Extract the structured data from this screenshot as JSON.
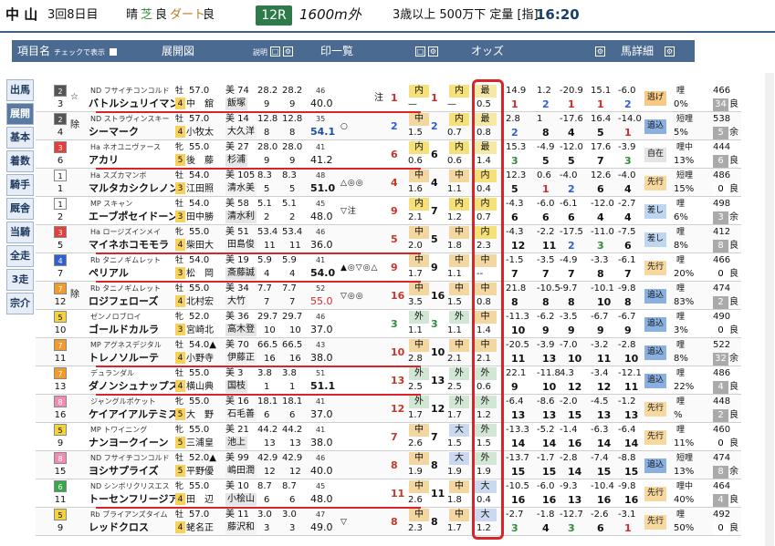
{
  "header": {
    "place": "中 山",
    "meeting": "3回8日目",
    "weather": "晴",
    "turf_label": "芝",
    "turf": "良",
    "dirt_label": "ダート",
    "dirt": "良",
    "race_num": "12R",
    "distance": "1600m外",
    "conditions": "3歳以上 500万下 定量 [指]",
    "post_time": "16:20"
  },
  "columns": {
    "name": "項目名",
    "check": "チェックで表示",
    "chart": "展開図",
    "chart_sub": "説明",
    "marks": "印一覧",
    "odds": "オッズ",
    "detail": "馬詳細"
  },
  "side": [
    "出馬",
    "展開",
    "基本",
    "着数",
    "騎手",
    "厩舎",
    "当騎",
    "全走",
    "3走",
    "宗介"
  ],
  "rows": [
    {
      "wk": "2",
      "n": "3",
      "mk": "☆",
      "ic": "ND",
      "sire": "フサイチコンコルド",
      "name": "バトルシュリイマン",
      "sex": "牡",
      "age": "4",
      "kg": "57.0",
      "jk": "中　舘",
      "tr": "美 74",
      "trn": "飯塚",
      "t1": "28.2",
      "t2": "28.2",
      "p1": "9",
      "p2": "9",
      "od1": "46",
      "od2": "40.0",
      "sy": "",
      "ta": "注",
      "nb": "1",
      "b1": "内",
      "v1": "—",
      "n1": "1",
      "b2": "内",
      "v2": "—",
      "ob": "最",
      "ov": "0.5",
      "c1": "14.9",
      "d1": "1",
      "c2": "1.2",
      "d2": "2",
      "c3": "-20.9",
      "d3": "1",
      "c4": "15.1",
      "d4": "1",
      "c5": "-6.0",
      "d5": "2",
      "sty": "逃げ",
      "ln": "哩",
      "pc": "0%",
      "wt": "466",
      "gd": "34",
      "cnd": "良"
    },
    {
      "wk": "2",
      "n": "4",
      "mk": "除",
      "ic": "ND",
      "sire": "ストラヴィンスキー",
      "name": "シーマーク",
      "sex": "牡",
      "age": "4",
      "kg": "57.0",
      "jk": "小牧太",
      "tr": "美 14",
      "trn": "大久洋",
      "t1": "12.8",
      "t2": "12.8",
      "p1": "8",
      "p2": "8",
      "od1": "35",
      "od2": "54.1",
      "sy": "○",
      "ta": "",
      "nb": "2",
      "b1": "中",
      "v1": "1.5",
      "n1": "2",
      "b2": "内",
      "v2": "0.7",
      "ob": "最",
      "ov": "0.8",
      "c1": "2.8",
      "d1": "2",
      "c2": "1",
      "d2": "8",
      "c3": "-17.6",
      "d3": "4",
      "c4": "16.4",
      "d4": "5",
      "c5": "-14.0",
      "d5": "1",
      "sty": "追込",
      "ln": "短哩",
      "pc": "5%",
      "wt": "538",
      "gd": "5",
      "cnd": "余"
    },
    {
      "wk": "3",
      "n": "6",
      "mk": "",
      "ic": "Ha",
      "sire": "ネオユニヴァース",
      "name": "アカリ",
      "sex": "牝",
      "age": "5",
      "kg": "55.0",
      "jk": "後　藤",
      "tr": "美 27",
      "trn": "杉浦",
      "t1": "28.0",
      "t2": "28.0",
      "p1": "9",
      "p2": "9",
      "od1": "41",
      "od2": "41.2",
      "sy": "",
      "ta": "",
      "nb": "6",
      "b1": "内",
      "v1": "0.6",
      "n1": "6",
      "b2": "内",
      "v2": "0.6",
      "ob": "最",
      "ov": "1.4",
      "c1": "15.3",
      "d1": "3",
      "c2": "-4.9",
      "d2": "5",
      "c3": "-12.0",
      "d3": "5",
      "c4": "17.6",
      "d4": "7",
      "c5": "-3.9",
      "d5": "3",
      "sty": "自在",
      "ln": "哩中",
      "pc": "13%",
      "wt": "444",
      "gd": "6",
      "cnd": "良"
    },
    {
      "wk": "1",
      "n": "1",
      "mk": "",
      "ic": "Ha",
      "sire": "スズカマンボ",
      "name": "マルタカシクレノン",
      "sex": "牡",
      "age": "3",
      "kg": "54.0",
      "jk": "江田照",
      "tr": "美 105",
      "trn": "清水美",
      "t1": "8.3",
      "t2": "8.3",
      "p1": "5",
      "p2": "5",
      "od1": "48",
      "od2": "51.0",
      "sy": "△◎◎",
      "ta": "",
      "nb": "4",
      "b1": "中",
      "v1": "1.6",
      "n1": "4",
      "b2": "中",
      "v2": "1.1",
      "ob": "内",
      "ov": "0.4",
      "c1": "12.3",
      "d1": "5",
      "c2": "0.6",
      "d2": "1",
      "c3": "-4.0",
      "d3": "2",
      "c4": "12.6",
      "d4": "6",
      "c5": "-4.0",
      "d5": "4",
      "sty": "先行",
      "ln": "短哩",
      "pc": "15%",
      "wt": "486",
      "gd": "0",
      "cnd": "良"
    },
    {
      "wk": "1",
      "n": "2",
      "mk": "",
      "ic": "MP",
      "sire": "スキャン",
      "name": "エーブポセイドーン",
      "sex": "牡",
      "age": "3",
      "kg": "54.0",
      "jk": "田中勝",
      "tr": "美 58",
      "trn": "清水利",
      "t1": "5.1",
      "t2": "5.1",
      "p1": "2",
      "p2": "2",
      "od1": "45",
      "od2": "48.0",
      "sy": "▽注",
      "ta": "",
      "nb": "9",
      "b1": "内",
      "v1": "2.1",
      "n1": "7",
      "b2": "内",
      "v2": "1.2",
      "ob": "内",
      "ov": "0.7",
      "c1": "-4.3",
      "d1": "6",
      "c2": "-6.0",
      "d2": "6",
      "c3": "-6.1",
      "d3": "6",
      "c4": "-12.0",
      "d4": "4",
      "c5": "-2.7",
      "d5": "4",
      "sty": "差し",
      "ln": "哩",
      "pc": "6%",
      "wt": "498",
      "gd": "3",
      "cnd": "余"
    },
    {
      "wk": "3",
      "n": "5",
      "mk": "",
      "ic": "Ha",
      "sire": "ロージズインメイ",
      "name": "マイネホコモモラ",
      "sex": "牝",
      "age": "4",
      "kg": "55.0",
      "jk": "柴田大",
      "tr": "美 51",
      "trn": "田島俊",
      "t1": "53.4",
      "t2": "53.4",
      "p1": "11",
      "p2": "11",
      "od1": "46",
      "od2": "36.0",
      "sy": "",
      "ta": "",
      "nb": "5",
      "b1": "中",
      "v1": "2.0",
      "n1": "5",
      "b2": "中",
      "v2": "1.8",
      "ob": "内",
      "ov": "2.3",
      "c1": "-4.3",
      "d1": "12",
      "c2": "-2.2",
      "d2": "11",
      "c3": "-17.5",
      "d3": "2",
      "c4": "-11.0",
      "d4": "3",
      "c5": "-7.5",
      "d5": "6",
      "sty": "差し",
      "ln": "哩",
      "pc": "8%",
      "wt": "412",
      "gd": "8",
      "cnd": "良"
    },
    {
      "wk": "4",
      "n": "7",
      "mk": "",
      "ic": "Rb",
      "sire": "タニノギムレット",
      "name": "ペリアル",
      "sex": "牡",
      "age": "3",
      "kg": "54.0",
      "jk": "松　岡",
      "tr": "美 19",
      "trn": "斎藤誠",
      "t1": "5.9",
      "t2": "5.9",
      "p1": "4",
      "p2": "4",
      "od1": "41",
      "od2": "54.0",
      "sy": "▲◎▽◎△",
      "ta": "",
      "nb": "9",
      "b1": "中",
      "v1": "1.7",
      "n1": "9",
      "b2": "中",
      "v2": "1.1",
      "ob": "中",
      "ov": "--",
      "c1": "-1.5",
      "d1": "7",
      "c2": "-3.5",
      "d2": "7",
      "c3": "-4.9",
      "d3": "7",
      "c4": "-3.3",
      "d4": "8",
      "c5": "-6.1",
      "d5": "7",
      "sty": "先行",
      "ln": "哩",
      "pc": "20%",
      "wt": "466",
      "gd": "0",
      "cnd": "良"
    },
    {
      "wk": "7",
      "n": "12",
      "mk": "除",
      "ic": "Rb",
      "sire": "タニノギムレット",
      "name": "ロジフェローズ",
      "sex": "牡",
      "age": "4",
      "kg": "55.0",
      "jk": "北村宏",
      "tr": "美 34",
      "trn": "大竹",
      "t1": "7.7",
      "t2": "7.7",
      "p1": "7",
      "p2": "7",
      "od1": "52",
      "od2": "55.0",
      "sy": "▽◎◎",
      "ta": "",
      "nb": "16",
      "b1": "中",
      "v1": "3.5",
      "n1": "16",
      "b2": "中",
      "v2": "1.5",
      "ob": "中",
      "ov": "0.8",
      "c1": "21.8",
      "d1": "8",
      "c2": "-10.5",
      "d2": "8",
      "c3": "-9.7",
      "d3": "8",
      "c4": "-10.1",
      "d4": "10",
      "c5": "-9.8",
      "d5": "8",
      "sty": "追込",
      "ln": "哩",
      "pc": "83%",
      "wt": "474",
      "gd": "2",
      "cnd": "良"
    },
    {
      "wk": "5",
      "n": "10",
      "mk": "",
      "ic": "",
      "sire": "ゼンノロブロイ",
      "name": "ゴールドカルラ",
      "sex": "牝",
      "age": "3",
      "kg": "52.0",
      "jk": "宮崎北",
      "tr": "美 36",
      "trn": "高木登",
      "t1": "29.7",
      "t2": "29.7",
      "p1": "10",
      "p2": "10",
      "od1": "46",
      "od2": "37.0",
      "sy": "",
      "ta": "",
      "nb": "3",
      "b1": "外",
      "v1": "1.1",
      "n1": "3",
      "b2": "外",
      "v2": "1.1",
      "ob": "中",
      "ov": "1.4",
      "c1": "-11.3",
      "d1": "10",
      "c2": "-6.2",
      "d2": "9",
      "c3": "-3.5",
      "d3": "9",
      "c4": "-6.7",
      "d4": "9",
      "c5": "-6.7",
      "d5": "9",
      "sty": "追込",
      "ln": "哩",
      "pc": "3%",
      "wt": "490",
      "gd": "0",
      "cnd": "良"
    },
    {
      "wk": "7",
      "n": "11",
      "mk": "",
      "ic": "MP",
      "sire": "アグネスデジタル",
      "name": "トレノソルーテ",
      "sex": "牡",
      "age": "4",
      "kg": "54.0▲",
      "jk": "小野寺",
      "tr": "美 70",
      "trn": "伊藤正",
      "t1": "66.5",
      "t2": "66.5",
      "p1": "16",
      "p2": "16",
      "od1": "43",
      "od2": "38.0",
      "sy": "",
      "ta": "",
      "nb": "10",
      "b1": "中",
      "v1": "2.8",
      "n1": "10",
      "b2": "中",
      "v2": "2.1",
      "ob": "中",
      "ov": "2.1",
      "c1": "-20.5",
      "d1": "11",
      "c2": "-3.9",
      "d2": "13",
      "c3": "-7.0",
      "d3": "10",
      "c4": "-3.2",
      "d4": "11",
      "c5": "-2.8",
      "d5": "10",
      "sty": "追込",
      "ln": "哩",
      "pc": "8%",
      "wt": "522",
      "gd": "32",
      "cnd": "余"
    },
    {
      "wk": "7",
      "n": "13",
      "mk": "",
      "ic": "",
      "sire": "デュランダル",
      "name": "ダノンシュナップス",
      "sex": "牡",
      "age": "4",
      "kg": "55.0",
      "jk": "横山典",
      "tr": "美 3",
      "trn": "国枝",
      "t1": "3.8",
      "t2": "3.8",
      "p1": "1",
      "p2": "1",
      "od1": "51",
      "od2": "51.1",
      "sy": "",
      "ta": "",
      "nb": "13",
      "b1": "外",
      "v1": "2.5",
      "n1": "13",
      "b2": "外",
      "v2": "2.5",
      "ob": "外",
      "ov": "0.6",
      "c1": "22.1",
      "d1": "9",
      "c2": "-11.8",
      "d2": "10",
      "c3": "4.3",
      "d3": "12",
      "c4": "-3.4",
      "d4": "12",
      "c5": "-12.1",
      "d5": "11",
      "sty": "追込",
      "ln": "哩",
      "pc": "22%",
      "wt": "486",
      "gd": "4",
      "cnd": "良"
    },
    {
      "wk": "8",
      "n": "16",
      "mk": "",
      "ic": "",
      "sire": "ジャングルポケット",
      "name": "ケイアイアルテミス",
      "sex": "牝",
      "age": "5",
      "kg": "55.0",
      "jk": "大　野",
      "tr": "美 16",
      "trn": "石毛善",
      "t1": "18.1",
      "t2": "18.1",
      "p1": "6",
      "p2": "6",
      "od1": "41",
      "od2": "37.0",
      "sy": "",
      "ta": "",
      "nb": "12",
      "b1": "外",
      "v1": "1.7",
      "n1": "12",
      "b2": "外",
      "v2": "1.7",
      "ob": "外",
      "ov": "1.2",
      "c1": "-6.4",
      "d1": "13",
      "c2": "-8.6",
      "d2": "13",
      "c3": "-2.0",
      "d3": "15",
      "c4": "-4.5",
      "d4": "13",
      "c5": "-1.2",
      "d5": "13",
      "sty": "先行",
      "ln": "哩",
      "pc": "%",
      "wt": "448",
      "gd": "2",
      "cnd": "良"
    },
    {
      "wk": "5",
      "n": "9",
      "mk": "",
      "ic": "MP",
      "sire": "トワイニング",
      "name": "ナンヨークイーン",
      "sex": "牝",
      "age": "5",
      "kg": "55.0",
      "jk": "三浦皇",
      "tr": "美 21",
      "trn": "池上",
      "t1": "44.2",
      "t2": "44.2",
      "p1": "13",
      "p2": "13",
      "od1": "41",
      "od2": "38.0",
      "sy": "",
      "ta": "",
      "nb": "7",
      "b1": "中",
      "v1": "2.6",
      "n1": "7",
      "b2": "大",
      "v2": "1.5",
      "ob": "外",
      "ov": "1.5",
      "c1": "-13.3",
      "d1": "14",
      "c2": "-5.2",
      "d2": "14",
      "c3": "-1.4",
      "d3": "16",
      "c4": "-6.3",
      "d4": "14",
      "c5": "-6.4",
      "d5": "14",
      "sty": "先行",
      "ln": "哩",
      "pc": "11%",
      "wt": "460",
      "gd": "0",
      "cnd": "良"
    },
    {
      "wk": "8",
      "n": "15",
      "mk": "",
      "ic": "ND",
      "sire": "フサイチコンコルド",
      "name": "ヨシサプライズ",
      "sex": "牡",
      "age": "5",
      "kg": "52.0▲",
      "jk": "平野優",
      "tr": "美 99",
      "trn": "嶋田潤",
      "t1": "42.9",
      "t2": "42.9",
      "p1": "12",
      "p2": "12",
      "od1": "46",
      "od2": "40.0",
      "sy": "",
      "ta": "",
      "nb": "8",
      "b1": "中",
      "v1": "1.9",
      "n1": "8",
      "b2": "大",
      "v2": "1.9",
      "ob": "外",
      "ov": "1.9",
      "c1": "-13.7",
      "d1": "15",
      "c2": "-1.7",
      "d2": "15",
      "c3": "-2.8",
      "d3": "14",
      "c4": "-7.4",
      "d4": "15",
      "c5": "-8.8",
      "d5": "15",
      "sty": "追込",
      "ln": "短哩",
      "pc": "13%",
      "wt": "474",
      "gd": "8",
      "cnd": "余"
    },
    {
      "wk": "6",
      "n": "11",
      "mk": "",
      "ic": "ND",
      "sire": "シンボリクリスエス",
      "name": "トーセンフリージア",
      "sex": "牝",
      "age": "4",
      "kg": "55.0",
      "jk": "田　辺",
      "tr": "美 10",
      "trn": "小桧山",
      "t1": "8.7",
      "t2": "8.7",
      "p1": "6",
      "p2": "6",
      "od1": "45",
      "od2": "48.0",
      "sy": "",
      "ta": "",
      "nb": "11",
      "b1": "中",
      "v1": "2.6",
      "n1": "11",
      "b2": "中",
      "v2": "1.8",
      "ob": "大",
      "ov": "0.4",
      "c1": "-10.5",
      "d1": "16",
      "c2": "-6.0",
      "d2": "16",
      "c3": "-9.3",
      "d3": "13",
      "c4": "-10.4",
      "d4": "16",
      "c5": "-9.8",
      "d5": "16",
      "sty": "先行",
      "ln": "哩中",
      "pc": "40%",
      "wt": "464",
      "gd": "4",
      "cnd": "良"
    },
    {
      "wk": "5",
      "n": "9",
      "mk": "",
      "ic": "Rb",
      "sire": "ブライアンズタイム",
      "name": "レッドクロス",
      "sex": "牡",
      "age": "4",
      "kg": "57.0",
      "jk": "蛯名正",
      "tr": "美 11",
      "trn": "藤沢和",
      "t1": "3.0",
      "t2": "3.0",
      "p1": "3",
      "p2": "3",
      "od1": "47",
      "od2": "49.0",
      "sy": "▽",
      "ta": "",
      "nb": "8",
      "b1": "中",
      "v1": "2.3",
      "n1": "8",
      "b2": "中",
      "v2": "1.7",
      "ob": "大",
      "ov": "1.2",
      "c1": "-2.7",
      "d1": "3",
      "c2": "-1.8",
      "d2": "4",
      "c3": "-12.7",
      "d3": "3",
      "c4": "-2.6",
      "d4": "6",
      "c5": "-3.1",
      "d5": "1",
      "sty": "先行",
      "ln": "哩",
      "pc": "50%",
      "wt": "492",
      "gd": "0",
      "cnd": "良"
    }
  ],
  "colors": {
    "header_band": "#4b6a91",
    "accent_red": "#d9252a",
    "brown": "#b57b2c",
    "green": "#2e8b3a"
  }
}
